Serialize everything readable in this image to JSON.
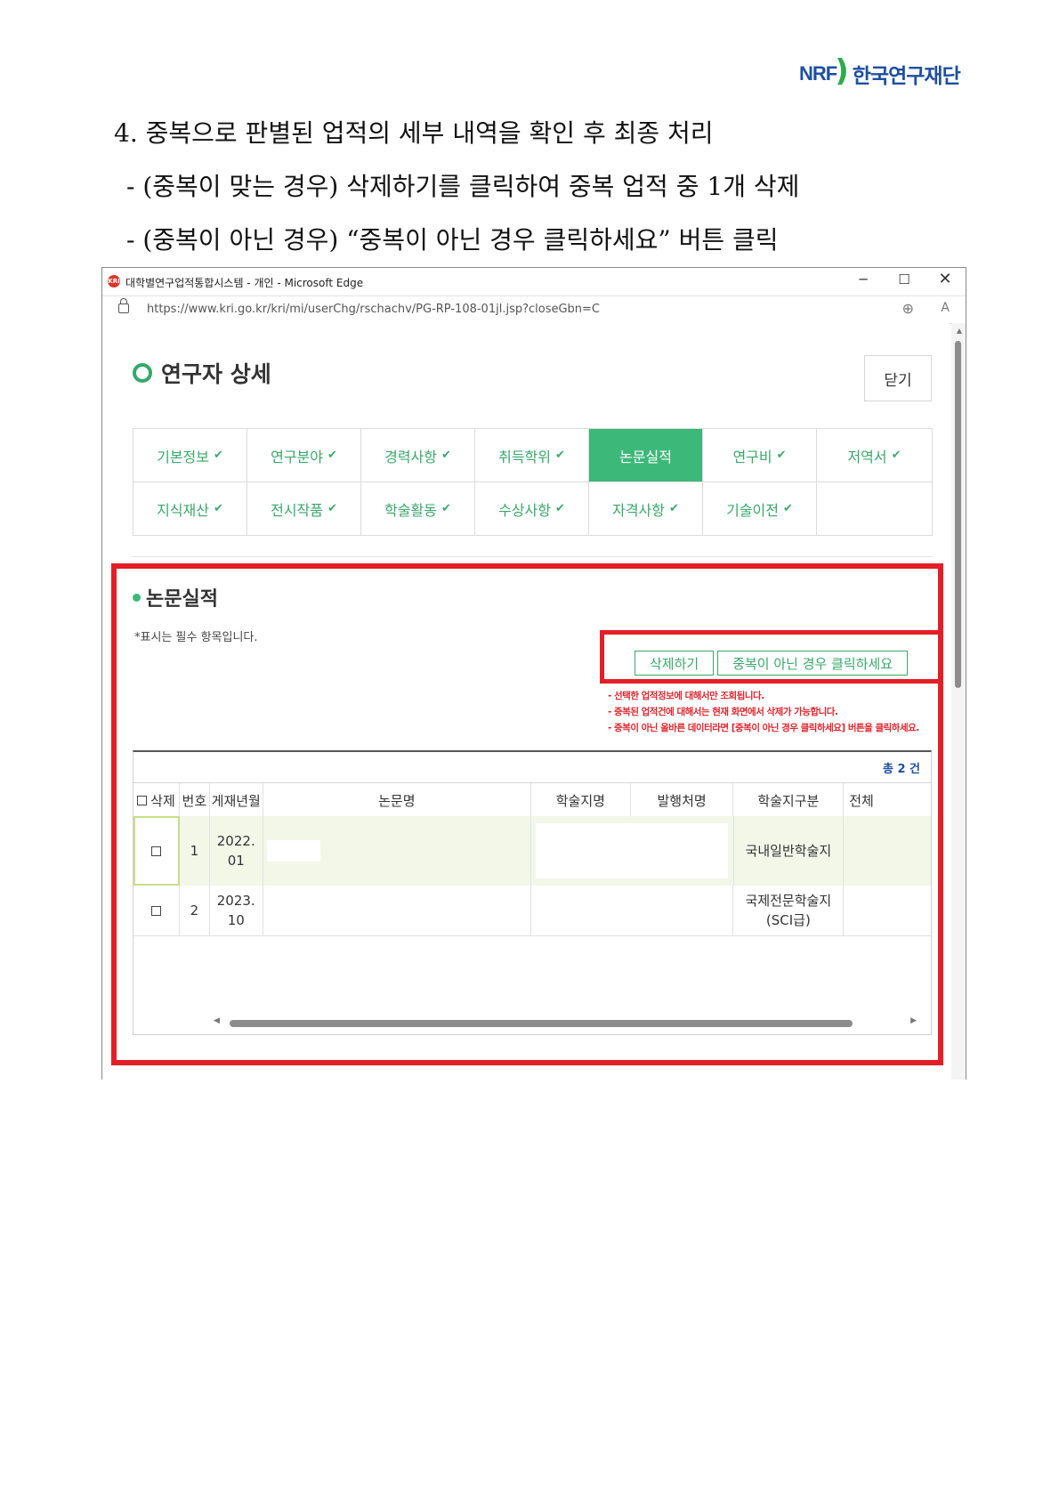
{
  "logo": {
    "mark": "NRF",
    "org": "한국연구재단"
  },
  "instructions": {
    "line1": "4. 중복으로 판별된 업적의 세부 내역을 확인 후 최종 처리",
    "line2": "- (중복이 맞는 경우) 삭제하기를 클릭하여 중복 업적 중 1개 삭제",
    "line3": "- (중복이 아닌 경우) “중복이 아닌 경우 클릭하세요” 버튼 클릭"
  },
  "browser": {
    "title": "대학별연구업적통합시스템 - 개인 - Microsoft Edge",
    "url": "https://www.kri.go.kr/kri/mi/userChg/rschachv/PG-RP-108-01jl.jsp?closeGbn=C",
    "controls": {
      "minimize": "─",
      "maximize": "☐",
      "close": "✕"
    },
    "icons": {
      "app": "KRI",
      "zoom": "⊕",
      "read_aloud": "A"
    }
  },
  "page": {
    "title": "연구자 상세",
    "close_button": "닫기",
    "tabs_row1": [
      "기본정보",
      "연구분야",
      "경력사항",
      "취득학위",
      "논문실적",
      "연구비",
      "저역서"
    ],
    "tabs_row2": [
      "지식재산",
      "전시작품",
      "학술활동",
      "수상사항",
      "자격사항",
      "기술이전"
    ],
    "active_tab": "논문실적",
    "section_title": "논문실적",
    "required_note": "*표시는 필수 항목입니다.",
    "buttons": {
      "delete": "삭제하기",
      "not_duplicate": "중복이 아닌 경우 클릭하세요"
    },
    "notices": [
      "- 선택한 업적정보에 대해서만 조회됩니다.",
      "- 중복된 업적건에 대해서는 현재 화면에서 삭제가 가능합니다.",
      "- 중복이 아닌 올바른 데이터라면 [중복이 아닌 경우 클릭하세요] 버튼을 클릭하세요."
    ],
    "table": {
      "total": "총 2 건",
      "headers": {
        "delete": "삭제",
        "no": "번호",
        "date": "게재년월",
        "paper": "논문명",
        "journal": "학술지명",
        "publisher": "발행처명",
        "type": "학술지구분",
        "all": "전체"
      },
      "rows": [
        {
          "no": "1",
          "date": "2022.01",
          "paper": "",
          "journal": "",
          "publisher": "",
          "type": "국내일반학술지"
        },
        {
          "no": "2",
          "date": "2023.10",
          "paper": "",
          "journal": "",
          "publisher": "",
          "type": "국제전문학술지(SCI급)"
        }
      ]
    }
  },
  "colors": {
    "accent": "#3cb878",
    "highlight": "#e41e26",
    "brand": "#1f4fa1"
  }
}
